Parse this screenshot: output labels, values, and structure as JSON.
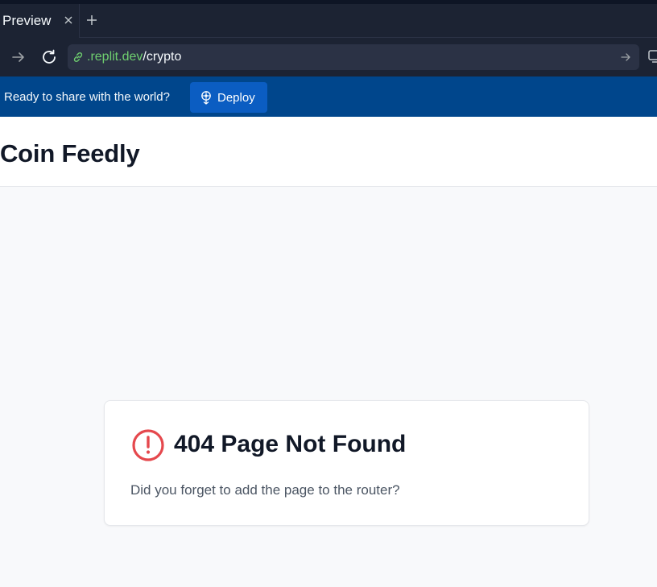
{
  "browser": {
    "tab": {
      "label": "Preview"
    },
    "url": {
      "host": ".replit.dev",
      "path": "/crypto"
    }
  },
  "deploy_banner": {
    "message": "Ready to share with the world?",
    "button_label": "Deploy"
  },
  "app": {
    "title": "Coin Feedly"
  },
  "not_found": {
    "heading": "404 Page Not Found",
    "message": "Did you forget to add the page to the router?"
  },
  "colors": {
    "tab_bar_bg": "#1c2333",
    "deploy_bar_bg": "#00468c",
    "deploy_button_bg": "#0b5dc2",
    "url_host": "#6fcf6f",
    "alert_red": "#e5484d",
    "page_bg": "#f8f9fb"
  },
  "icons": {
    "tab_close": "close-icon",
    "tab_add": "plus-icon",
    "forward": "arrow-right-icon",
    "reload": "reload-icon",
    "url_link": "link-icon",
    "url_go": "arrow-right-icon",
    "device": "device-icon",
    "deploy": "deploy-icon",
    "alert": "alert-circle-icon"
  }
}
